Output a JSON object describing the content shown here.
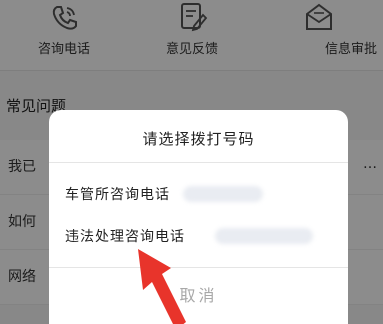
{
  "shortcuts": [
    {
      "label": "咨询电话",
      "icon": "phone-icon"
    },
    {
      "label": "意见反馈",
      "icon": "feedback-edit-icon"
    },
    {
      "label": "信息审批",
      "icon": "envelope-icon"
    }
  ],
  "faq": {
    "title": "常见问题",
    "rows": [
      {
        "text": "我已",
        "tail": "…"
      },
      {
        "text": "如何",
        "tail": ""
      },
      {
        "text": "网络",
        "tail": ""
      }
    ]
  },
  "dialog": {
    "title": "请选择拨打号码",
    "options": [
      {
        "label": "车管所咨询电话"
      },
      {
        "label": "违法处理咨询电话"
      }
    ],
    "cancel_label": "取消"
  },
  "colors": {
    "overlay": "#000000",
    "dialog_bg": "#ffffff",
    "cancel_text": "#a8a8a8",
    "arrow": "#e8342b"
  }
}
